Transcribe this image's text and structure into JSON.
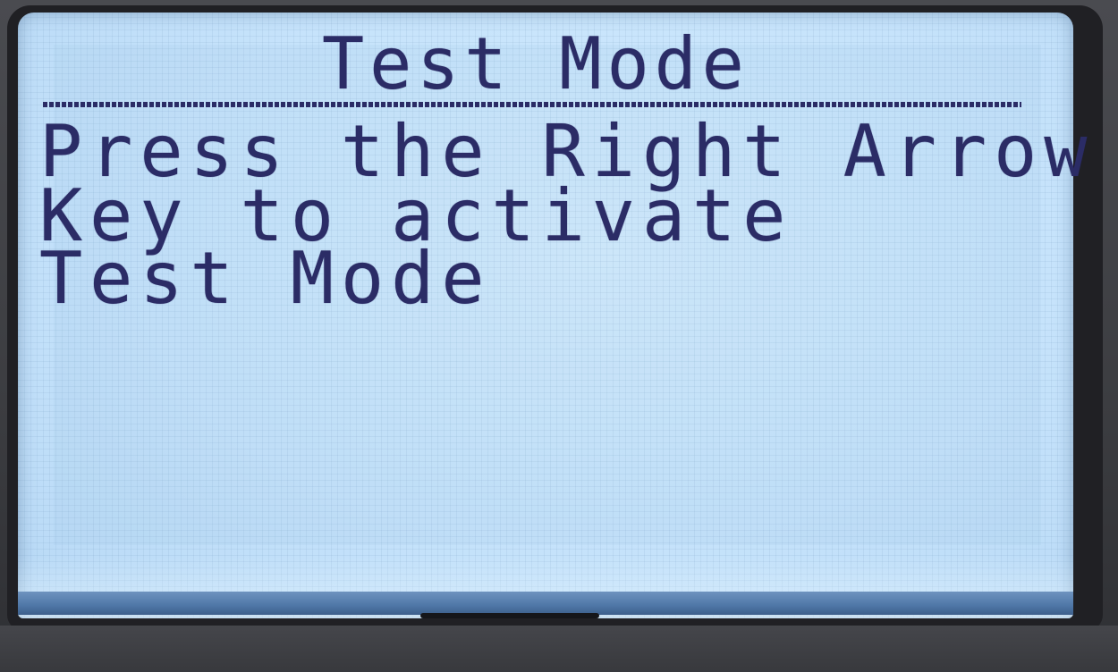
{
  "screen": {
    "title": "Test Mode",
    "lines": [
      "Press the Right Arrow",
      "Key to activate",
      "Test Mode"
    ]
  },
  "colors": {
    "lcd_background": "#c6e3fb",
    "lcd_text": "#2b2c66",
    "bezel": "#202024"
  }
}
